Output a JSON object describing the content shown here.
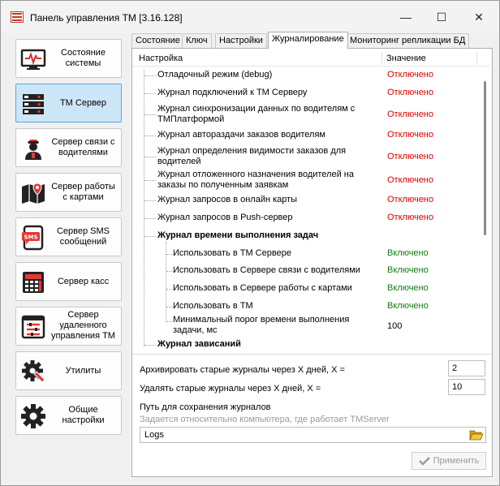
{
  "window": {
    "title": "Панель управления ТМ [3.16.128]",
    "min_glyph": "—",
    "max_glyph": "☐",
    "close_glyph": "✕"
  },
  "nav": [
    {
      "label": "Состояние системы",
      "icon": "system-status-icon",
      "active": false
    },
    {
      "label": "ТМ Сервер",
      "icon": "server-icon",
      "active": true
    },
    {
      "label": "Сервер связи с водителями",
      "icon": "driver-icon",
      "active": false
    },
    {
      "label": "Сервер работы с картами",
      "icon": "map-icon",
      "active": false
    },
    {
      "label": "Сервер SMS сообщений",
      "icon": "sms-icon",
      "active": false
    },
    {
      "label": "Сервер касс",
      "icon": "cash-register-icon",
      "active": false
    },
    {
      "label": "Сервер удаленного управления ТМ",
      "icon": "remote-control-icon",
      "active": false
    },
    {
      "label": "Утилиты",
      "icon": "utilities-icon",
      "active": false
    },
    {
      "label": "Общие настройки",
      "icon": "settings-gear-icon",
      "active": false
    }
  ],
  "tabs": [
    {
      "label": "Состояние",
      "active": false
    },
    {
      "label": "Ключ",
      "active": false
    },
    {
      "label": "Настройки",
      "active": false
    },
    {
      "label": "Журналирование",
      "active": true
    },
    {
      "label": "Мониторинг репликации БД",
      "active": false
    }
  ],
  "grid": {
    "col_setting": "Настройка",
    "col_value": "Значение",
    "rows": [
      {
        "name": "Отладочный режим (debug)",
        "value": "Отключено",
        "state": "off",
        "level": 1
      },
      {
        "name": "Журнал подключений к ТМ Серверу",
        "value": "Отключено",
        "state": "off",
        "level": 1
      },
      {
        "name": "Журнал синхронизации данных по водителям с ТМПлатформой",
        "value": "Отключено",
        "state": "off",
        "level": 1
      },
      {
        "name": "Журнал автораздачи заказов водителям",
        "value": "Отключено",
        "state": "off",
        "level": 1
      },
      {
        "name": "Журнал определения видимости заказов для водителей",
        "value": "Отключено",
        "state": "off",
        "level": 1
      },
      {
        "name": "Журнал отложенного назначения водителей на заказы по полученным заявкам",
        "value": "Отключено",
        "state": "off",
        "level": 1
      },
      {
        "name": "Журнал запросов в онлайн карты",
        "value": "Отключено",
        "state": "off",
        "level": 1
      },
      {
        "name": "Журнал запросов в Push-сервер",
        "value": "Отключено",
        "state": "off",
        "level": 1
      },
      {
        "name": "Журнал времени выполнения задач",
        "value": "",
        "state": "group",
        "level": 1
      },
      {
        "name": "Использовать в ТМ Сервере",
        "value": "Включено",
        "state": "on",
        "level": 2
      },
      {
        "name": "Использовать в Сервере связи с водителями",
        "value": "Включено",
        "state": "on",
        "level": 2
      },
      {
        "name": "Использовать в Сервере работы с картами",
        "value": "Включено",
        "state": "on",
        "level": 2
      },
      {
        "name": "Использовать в ТМ",
        "value": "Включено",
        "state": "on",
        "level": 2
      },
      {
        "name": "Минимальный порог времени выполнения задачи, мс",
        "value": "100",
        "state": "num",
        "level": 2
      },
      {
        "name": "Журнал зависаний",
        "value": "",
        "state": "group",
        "level": 1
      }
    ]
  },
  "archive": {
    "label": "Архивировать старые журналы через X дней, X =",
    "value": "2"
  },
  "delete": {
    "label": "Удалять старые журналы через X дней, X =",
    "value": "10"
  },
  "path": {
    "label": "Путь для сохранения журналов",
    "hint": "Задается относительно компьютера, где работает TMServer",
    "value": "Logs"
  },
  "apply_label": "Применить",
  "colors": {
    "off": "#e00000",
    "on": "#107c10",
    "active_nav": "#cde6f7"
  }
}
